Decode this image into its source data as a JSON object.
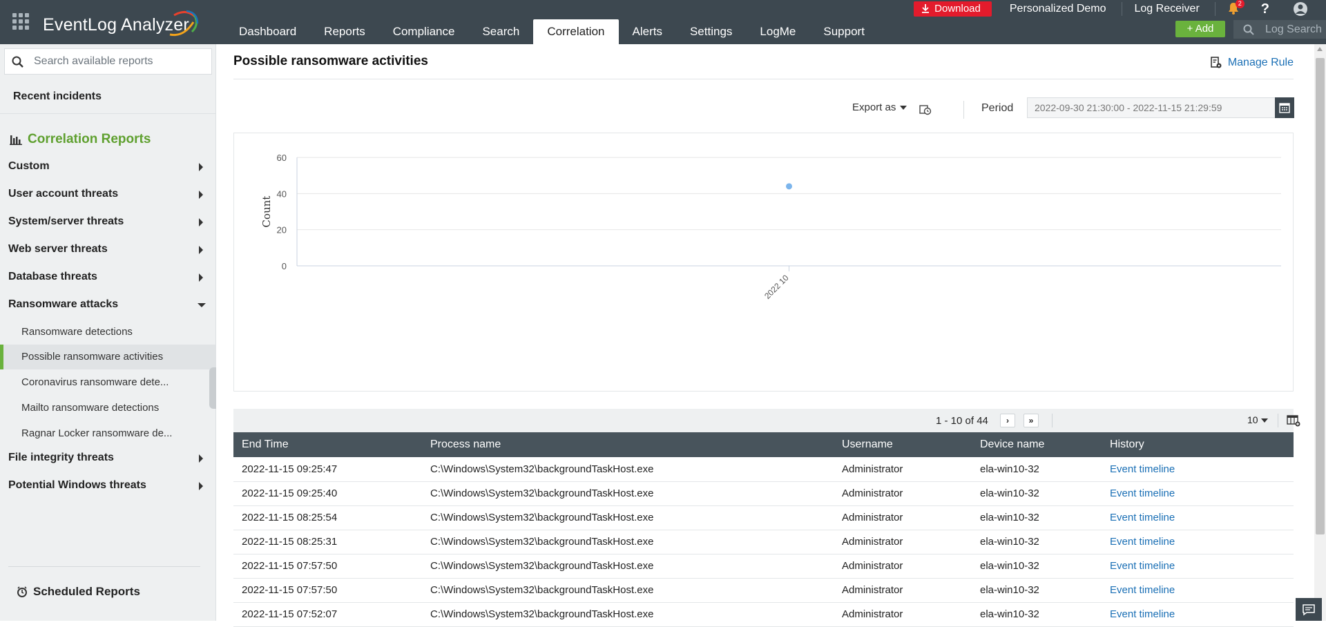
{
  "app": {
    "name": "EventLog Analyzer"
  },
  "header": {
    "nav": [
      "Dashboard",
      "Reports",
      "Compliance",
      "Search",
      "Correlation",
      "Alerts",
      "Settings",
      "LogMe",
      "Support"
    ],
    "active_nav": "Correlation",
    "download_label": "Download",
    "personalized_demo": "Personalized Demo",
    "log_receiver": "Log Receiver",
    "notification_count": "2",
    "help_label": "?",
    "add_label": "Add",
    "search_placeholder": "Log Search"
  },
  "sidebar": {
    "search_placeholder": "Search available reports",
    "recent_incidents": "Recent incidents",
    "section_title": "Correlation Reports",
    "categories": [
      "Custom",
      "User account threats",
      "System/server threats",
      "Web server threats",
      "Database threats",
      "Ransomware attacks",
      "File integrity threats",
      "Potential Windows threats"
    ],
    "ransomware_items": [
      "Ransomware detections",
      "Possible ransomware activities",
      "Coronavirus ransomware dete...",
      "Mailto ransomware detections",
      "Ragnar Locker ransomware de..."
    ],
    "active_item": "Possible ransomware activities",
    "scheduled_reports": "Scheduled Reports"
  },
  "report": {
    "title": "Possible ransomware activities",
    "manage_rule": "Manage Rule",
    "export_as": "Export as",
    "period_label": "Period",
    "period_value": "2022-09-30 21:30:00 - 2022-11-15 21:29:59"
  },
  "chart_data": {
    "type": "scatter",
    "ylabel": "Count",
    "xlabel": "",
    "title": "",
    "categories": [
      "2022 10"
    ],
    "values": [
      44
    ],
    "ylim": [
      0,
      60
    ],
    "yticks": [
      0,
      20,
      40,
      60
    ],
    "grid": true,
    "color": "#7cb5ec"
  },
  "table": {
    "pager": "1 - 10 of 44",
    "per_page": "10",
    "columns": [
      "End Time",
      "Process name",
      "Username",
      "Device name",
      "History"
    ],
    "rows": [
      [
        "2022-11-15 09:25:47",
        "C:\\Windows\\System32\\backgroundTaskHost.exe",
        "Administrator",
        "ela-win10-32",
        "Event timeline"
      ],
      [
        "2022-11-15 09:25:40",
        "C:\\Windows\\System32\\backgroundTaskHost.exe",
        "Administrator",
        "ela-win10-32",
        "Event timeline"
      ],
      [
        "2022-11-15 08:25:54",
        "C:\\Windows\\System32\\backgroundTaskHost.exe",
        "Administrator",
        "ela-win10-32",
        "Event timeline"
      ],
      [
        "2022-11-15 08:25:31",
        "C:\\Windows\\System32\\backgroundTaskHost.exe",
        "Administrator",
        "ela-win10-32",
        "Event timeline"
      ],
      [
        "2022-11-15 07:57:50",
        "C:\\Windows\\System32\\backgroundTaskHost.exe",
        "Administrator",
        "ela-win10-32",
        "Event timeline"
      ],
      [
        "2022-11-15 07:57:50",
        "C:\\Windows\\System32\\backgroundTaskHost.exe",
        "Administrator",
        "ela-win10-32",
        "Event timeline"
      ],
      [
        "2022-11-15 07:52:07",
        "C:\\Windows\\System32\\backgroundTaskHost.exe",
        "Administrator",
        "ela-win10-32",
        "Event timeline"
      ]
    ]
  },
  "colors": {
    "topbar": "#3d4850",
    "accent_green": "#6ab23d",
    "section_green": "#5fa02f",
    "download_red": "#e31b2c",
    "link_blue": "#1a6fb5",
    "table_header": "#48545c"
  }
}
